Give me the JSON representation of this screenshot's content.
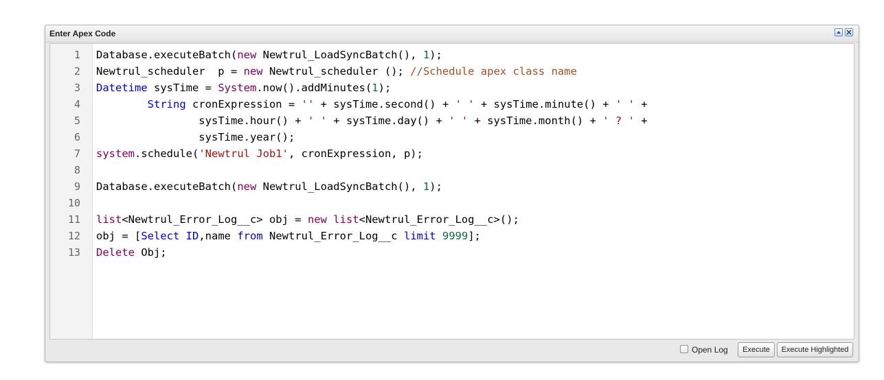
{
  "panel": {
    "title": "Enter Apex Code",
    "collapse_icon": "collapse-icon",
    "close_icon": "close-icon"
  },
  "editor": {
    "line_numbers": [
      "1",
      "2",
      "3",
      "4",
      "5",
      "6",
      "7",
      "8",
      "9",
      "10",
      "11",
      "12",
      "13"
    ],
    "lines": [
      [
        [
          "ident",
          "Database.executeBatch("
        ],
        [
          "kw",
          "new"
        ],
        [
          "ident",
          " Newtrul_LoadSyncBatch(), "
        ],
        [
          "num",
          "1"
        ],
        [
          "ident",
          ");"
        ]
      ],
      [
        [
          "ident",
          "Newtrul_scheduler  p = "
        ],
        [
          "kw",
          "new"
        ],
        [
          "ident",
          " Newtrul_scheduler (); "
        ],
        [
          "com",
          "//Schedule apex class name"
        ]
      ],
      [
        [
          "type",
          "Datetime"
        ],
        [
          "ident",
          " sysTime = "
        ],
        [
          "cls",
          "System"
        ],
        [
          "ident",
          ".now().addMinutes("
        ],
        [
          "num",
          "1"
        ],
        [
          "ident",
          ");"
        ]
      ],
      [
        [
          "ident",
          "        "
        ],
        [
          "type",
          "String"
        ],
        [
          "ident",
          " cronExpression = "
        ],
        [
          "str",
          "''"
        ],
        [
          "ident",
          " + sysTime.second() + "
        ],
        [
          "str",
          "' '"
        ],
        [
          "ident",
          " + sysTime.minute() + "
        ],
        [
          "str",
          "' '"
        ],
        [
          "ident",
          " +"
        ]
      ],
      [
        [
          "ident",
          "                sysTime.hour() + "
        ],
        [
          "str",
          "' '"
        ],
        [
          "ident",
          " + sysTime.day() + "
        ],
        [
          "str",
          "' '"
        ],
        [
          "ident",
          " + sysTime.month() + "
        ],
        [
          "str",
          "' ? '"
        ],
        [
          "ident",
          " +"
        ]
      ],
      [
        [
          "ident",
          "                sysTime.year();"
        ]
      ],
      [
        [
          "cls",
          "system"
        ],
        [
          "ident",
          ".schedule("
        ],
        [
          "str",
          "'Newtrul Job1'"
        ],
        [
          "ident",
          ", cronExpression, p);"
        ]
      ],
      [],
      [
        [
          "ident",
          "Database.executeBatch("
        ],
        [
          "kw",
          "new"
        ],
        [
          "ident",
          " Newtrul_LoadSyncBatch(), "
        ],
        [
          "num",
          "1"
        ],
        [
          "ident",
          ");"
        ]
      ],
      [],
      [
        [
          "kw",
          "list"
        ],
        [
          "ident",
          "<Newtrul_Error_Log__c> obj = "
        ],
        [
          "kw",
          "new"
        ],
        [
          "ident",
          " "
        ],
        [
          "kw",
          "list"
        ],
        [
          "ident",
          "<Newtrul_Error_Log__c>();"
        ]
      ],
      [
        [
          "ident",
          "obj = ["
        ],
        [
          "type",
          "Select"
        ],
        [
          "ident",
          " "
        ],
        [
          "type",
          "ID"
        ],
        [
          "ident",
          ",name "
        ],
        [
          "type",
          "from"
        ],
        [
          "ident",
          " Newtrul_Error_Log__c "
        ],
        [
          "type",
          "limit"
        ],
        [
          "ident",
          " "
        ],
        [
          "num",
          "9999"
        ],
        [
          "ident",
          "];"
        ]
      ],
      [
        [
          "kw",
          "Delete"
        ],
        [
          "ident",
          " Obj;"
        ]
      ]
    ]
  },
  "footer": {
    "open_log_label": "Open Log",
    "open_log_checked": false,
    "execute_label": "Execute",
    "execute_highlighted_label": "Execute Highlighted"
  },
  "colors": {
    "keyword": "#7f0055",
    "type": "#0000c8",
    "string": "#a31515",
    "number": "#116644",
    "comment": "#a0522d"
  }
}
